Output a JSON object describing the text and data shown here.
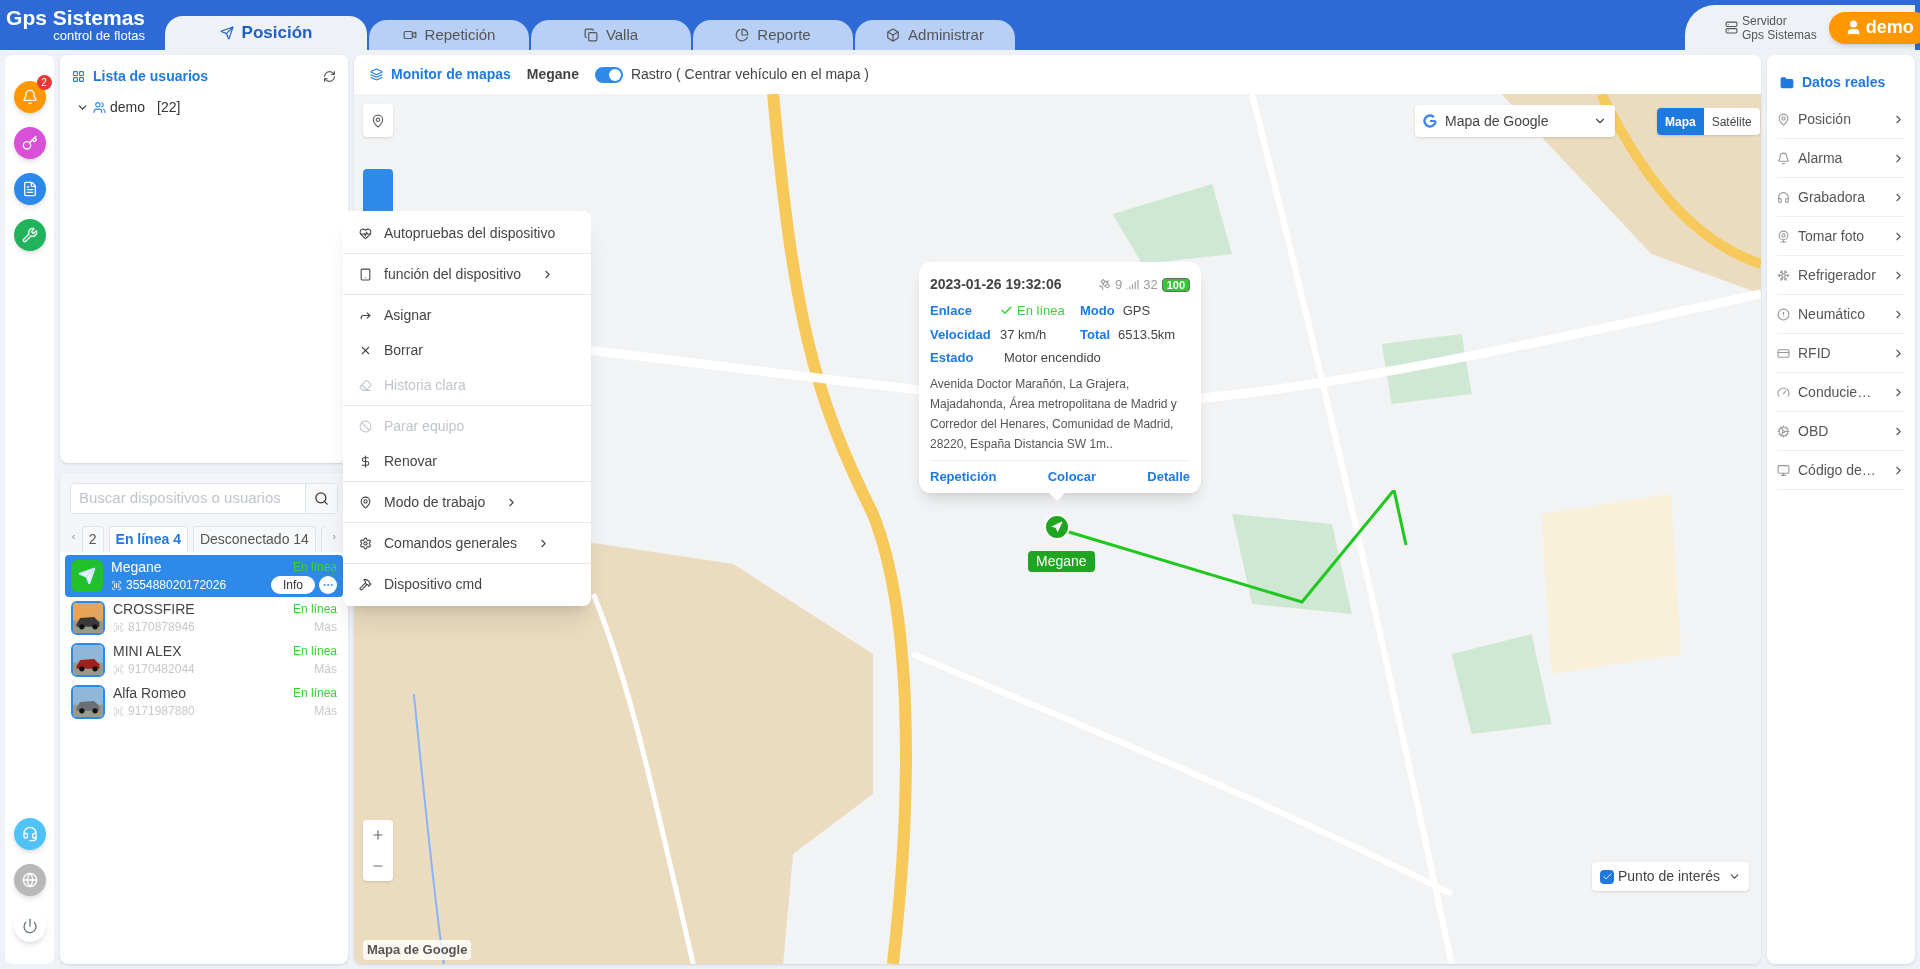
{
  "header": {
    "logo_title": "Gps Sistemas",
    "logo_subtitle": "control de flotas",
    "tabs": [
      {
        "label": "Posición",
        "selected": true
      },
      {
        "label": "Repetición",
        "selected": false
      },
      {
        "label": "Valla",
        "selected": false
      },
      {
        "label": "Reporte",
        "selected": false
      },
      {
        "label": "Administrar",
        "selected": false
      }
    ],
    "server": {
      "label": "Servidor",
      "name": "Gps Sistemas"
    },
    "user_button": "demo"
  },
  "rail": {
    "top": [
      {
        "color": "#ff9800",
        "badge": "2"
      },
      {
        "color": "#d94fd8"
      },
      {
        "color": "#2b8ae8"
      },
      {
        "color": "#21b35c"
      }
    ],
    "bottom": [
      {
        "color": "#4fc3f7"
      },
      {
        "color": "#b8b8b8"
      },
      {
        "color": "#ffffff"
      }
    ]
  },
  "user_list": {
    "title": "Lista de usuarios",
    "tree": [
      {
        "label": "demo",
        "count": "[22]",
        "expanded": true
      }
    ]
  },
  "device_panel": {
    "search": {
      "placeholder": "Buscar dispositivos o usuarios"
    },
    "tabs": [
      {
        "label": "2",
        "selected": false
      },
      {
        "label": "En línea 4",
        "selected": true
      },
      {
        "label": "Desconectado 14",
        "selected": false
      }
    ],
    "devices": [
      {
        "name": "Megane",
        "id": "355488020172026",
        "status": "En línea",
        "selected": true,
        "info_button": "Info",
        "kind": "app"
      },
      {
        "name": "CROSSFIRE",
        "id": "8170878946",
        "status": "En línea",
        "more": "Más",
        "selected": false,
        "kind": "picture"
      },
      {
        "name": "MINI ALEX",
        "id": "9170482044",
        "status": "En línea",
        "more": "Más",
        "selected": false,
        "kind": "picture"
      },
      {
        "name": "Alfa Romeo",
        "id": "9171987880",
        "status": "En línea",
        "more": "Más",
        "selected": false,
        "kind": "picture"
      }
    ]
  },
  "map": {
    "title": "Monitor de mapas",
    "vehicle": "Megane",
    "trace": {
      "on": true,
      "label": "Rastro ( Centrar vehículo en el mapa )"
    },
    "map_type": "Mapa de Google",
    "view_toggle": [
      {
        "label": "Mapa",
        "selected": true
      },
      {
        "label": "Satélite",
        "selected": false
      }
    ],
    "poi": {
      "label": "Punto de interés",
      "checked": true
    },
    "attribution": "Mapa de Google",
    "marker": {
      "label": "Megane"
    },
    "popup": {
      "datetime": "2023-01-26 19:32:06",
      "satellites": "9",
      "signal": "32",
      "battery": "100",
      "fields": [
        {
          "label": "Enlace",
          "value": "En línea",
          "kind": "status"
        },
        {
          "label": "Modo",
          "value": "GPS",
          "kind": "text"
        },
        {
          "label": "Velocidad",
          "value": "37 km/h",
          "kind": "text"
        },
        {
          "label": "Total",
          "value": "6513.5km",
          "kind": "text"
        },
        {
          "label": "Estado",
          "value": "Motor encendido",
          "kind": "text"
        }
      ],
      "address": "Avenida Doctor Marañón, La Grajera, Majadahonda, Área metropolitana de Madrid y Corredor del Henares, Comunidad de Madrid, 28220, España Distancia SW 1m..",
      "actions": [
        "Repetición",
        "Colocar",
        "Detalle"
      ]
    }
  },
  "context_menu": [
    [
      {
        "label": "Autopruebas del dispositivo",
        "disabled": false,
        "submenu": false
      }
    ],
    [
      {
        "label": "función del dispositivo",
        "disabled": false,
        "submenu": true
      }
    ],
    [
      {
        "label": "Asignar",
        "disabled": false,
        "submenu": false
      },
      {
        "label": "Borrar",
        "disabled": false,
        "submenu": false
      },
      {
        "label": "Historia clara",
        "disabled": true,
        "submenu": false
      }
    ],
    [
      {
        "label": "Parar equipo",
        "disabled": true,
        "submenu": false
      },
      {
        "label": "Renovar",
        "disabled": false,
        "submenu": false
      }
    ],
    [
      {
        "label": "Modo de trabajo",
        "disabled": false,
        "submenu": true
      }
    ],
    [
      {
        "label": "Comandos generales",
        "disabled": false,
        "submenu": true
      }
    ],
    [
      {
        "label": "Dispositivo cmd",
        "disabled": false,
        "submenu": false
      }
    ]
  ],
  "right_panel": {
    "title": "Datos reales",
    "items": [
      "Posición",
      "Alarma",
      "Grabadora",
      "Tomar foto",
      "Refrigerador",
      "Neumático",
      "RFID",
      "Conducie…",
      "OBD",
      "Código de…"
    ]
  }
}
